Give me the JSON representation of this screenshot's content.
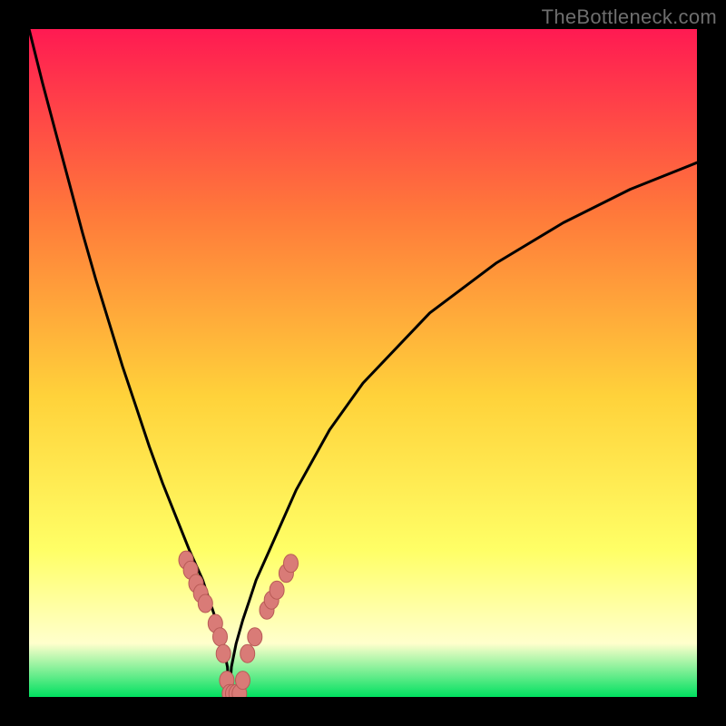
{
  "watermark": "TheBottleneck.com",
  "colors": {
    "gradient_top": "#ff1a52",
    "gradient_upper_mid": "#ff7a3a",
    "gradient_mid": "#ffd23a",
    "gradient_lower_mid": "#ffff66",
    "gradient_pale": "#ffffcc",
    "gradient_bottom": "#00e060",
    "curve": "#000000",
    "marker_fill": "#d97b77",
    "marker_stroke": "#b85a56"
  },
  "chart_data": {
    "type": "line",
    "title": "",
    "xlabel": "",
    "ylabel": "",
    "x": [
      0,
      2,
      4,
      6,
      8,
      10,
      12,
      14,
      16,
      18,
      20,
      22,
      24,
      26,
      27,
      28,
      29,
      29.7,
      30,
      30.3,
      31,
      32,
      33,
      34,
      36,
      40,
      45,
      50,
      60,
      70,
      80,
      90,
      100
    ],
    "y": [
      100,
      92,
      84.5,
      77,
      69.5,
      62.5,
      56,
      49.5,
      43.5,
      37.5,
      32,
      27,
      22,
      17.5,
      14.5,
      11.5,
      8,
      4.5,
      0,
      4.5,
      8,
      11.5,
      14.5,
      17.5,
      22,
      31,
      40,
      47,
      57.5,
      65,
      71,
      76,
      80
    ],
    "xlim": [
      0,
      100
    ],
    "ylim": [
      0,
      100
    ],
    "markers": [
      {
        "x": 23.5,
        "y": 20.5
      },
      {
        "x": 24.2,
        "y": 19
      },
      {
        "x": 25,
        "y": 17
      },
      {
        "x": 25.7,
        "y": 15.5
      },
      {
        "x": 26.4,
        "y": 14
      },
      {
        "x": 27.9,
        "y": 11
      },
      {
        "x": 28.6,
        "y": 9
      },
      {
        "x": 29.1,
        "y": 6.5
      },
      {
        "x": 29.6,
        "y": 2.5
      },
      {
        "x": 30,
        "y": 0.5
      },
      {
        "x": 30.5,
        "y": 0.5
      },
      {
        "x": 31,
        "y": 0.5
      },
      {
        "x": 31.5,
        "y": 0.5
      },
      {
        "x": 32,
        "y": 2.5
      },
      {
        "x": 32.7,
        "y": 6.5
      },
      {
        "x": 33.8,
        "y": 9
      },
      {
        "x": 35.6,
        "y": 13
      },
      {
        "x": 36.3,
        "y": 14.5
      },
      {
        "x": 37.1,
        "y": 16
      },
      {
        "x": 38.5,
        "y": 18.5
      },
      {
        "x": 39.2,
        "y": 20
      }
    ]
  }
}
